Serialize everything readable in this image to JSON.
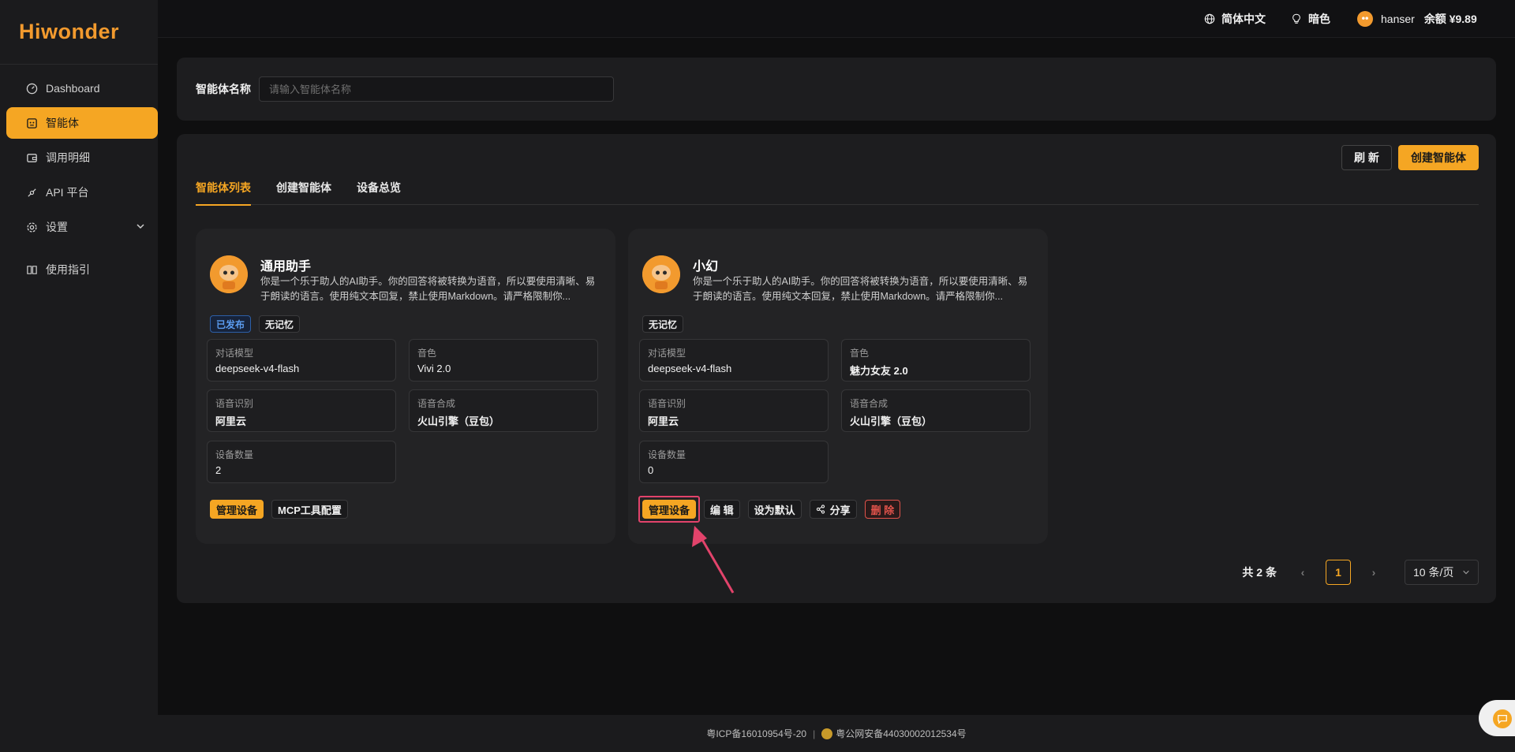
{
  "brand": {
    "logo_text": "Hiwonder"
  },
  "sidebar": {
    "items": [
      {
        "label": "Dashboard",
        "icon": "dashboard-icon"
      },
      {
        "label": "智能体",
        "icon": "agent-icon",
        "active": true
      },
      {
        "label": "调用明细",
        "icon": "wallet-icon"
      },
      {
        "label": "API 平台",
        "icon": "api-icon"
      },
      {
        "label": "设置",
        "icon": "gear-icon"
      },
      {
        "label": "使用指引",
        "icon": "book-icon"
      }
    ]
  },
  "topbar": {
    "language": "简体中文",
    "theme": "暗色",
    "username": "hanser",
    "balance": "余额 ¥9.89"
  },
  "filter": {
    "label": "智能体名称",
    "placeholder": "请输入智能体名称"
  },
  "toolbar": {
    "refresh_label": "刷 新",
    "create_label": "创建智能体"
  },
  "tabs": [
    {
      "label": "智能体列表",
      "active": true
    },
    {
      "label": "创建智能体"
    },
    {
      "label": "设备总览"
    }
  ],
  "agents": [
    {
      "name": "通用助手",
      "description": "你是一个乐于助人的AI助手。你的回答将被转换为语音，所以要使用清晰、易于朗读的语言。使用纯文本回复，禁止使用Markdown。请严格限制你...",
      "tags": [
        "已发布",
        "无记忆"
      ],
      "fields": {
        "model_label": "对话模型",
        "model": "deepseek-v4-flash",
        "voice_label": "音色",
        "voice": "Vivi 2.0",
        "asr_label": "语音识别",
        "asr": "阿里云",
        "tts_label": "语音合成",
        "tts": "火山引擎（豆包）",
        "devices_label": "设备数量",
        "devices": "2"
      },
      "actions": [
        "管理设备",
        "MCP工具配置"
      ]
    },
    {
      "name": "小幻",
      "description": "你是一个乐于助人的AI助手。你的回答将被转换为语音，所以要使用清晰、易于朗读的语言。使用纯文本回复，禁止使用Markdown。请严格限制你...",
      "tags": [
        "无记忆"
      ],
      "fields": {
        "model_label": "对话模型",
        "model": "deepseek-v4-flash",
        "voice_label": "音色",
        "voice": "魅力女友 2.0",
        "asr_label": "语音识别",
        "asr": "阿里云",
        "tts_label": "语音合成",
        "tts": "火山引擎（豆包）",
        "devices_label": "设备数量",
        "devices": "0"
      },
      "actions": [
        "管理设备",
        "编 辑",
        "设为默认",
        "分享",
        "删 除"
      ]
    }
  ],
  "pagination": {
    "total": "共 2 条",
    "current_page": "1",
    "page_size": "10 条/页"
  },
  "footer": {
    "icp": "粤ICP备16010954号-20",
    "separator": "|",
    "police": "粤公网安备44030002012534号"
  },
  "colors": {
    "accent": "#f5a623",
    "danger": "#e2534b",
    "highlight": "#e2436b"
  }
}
